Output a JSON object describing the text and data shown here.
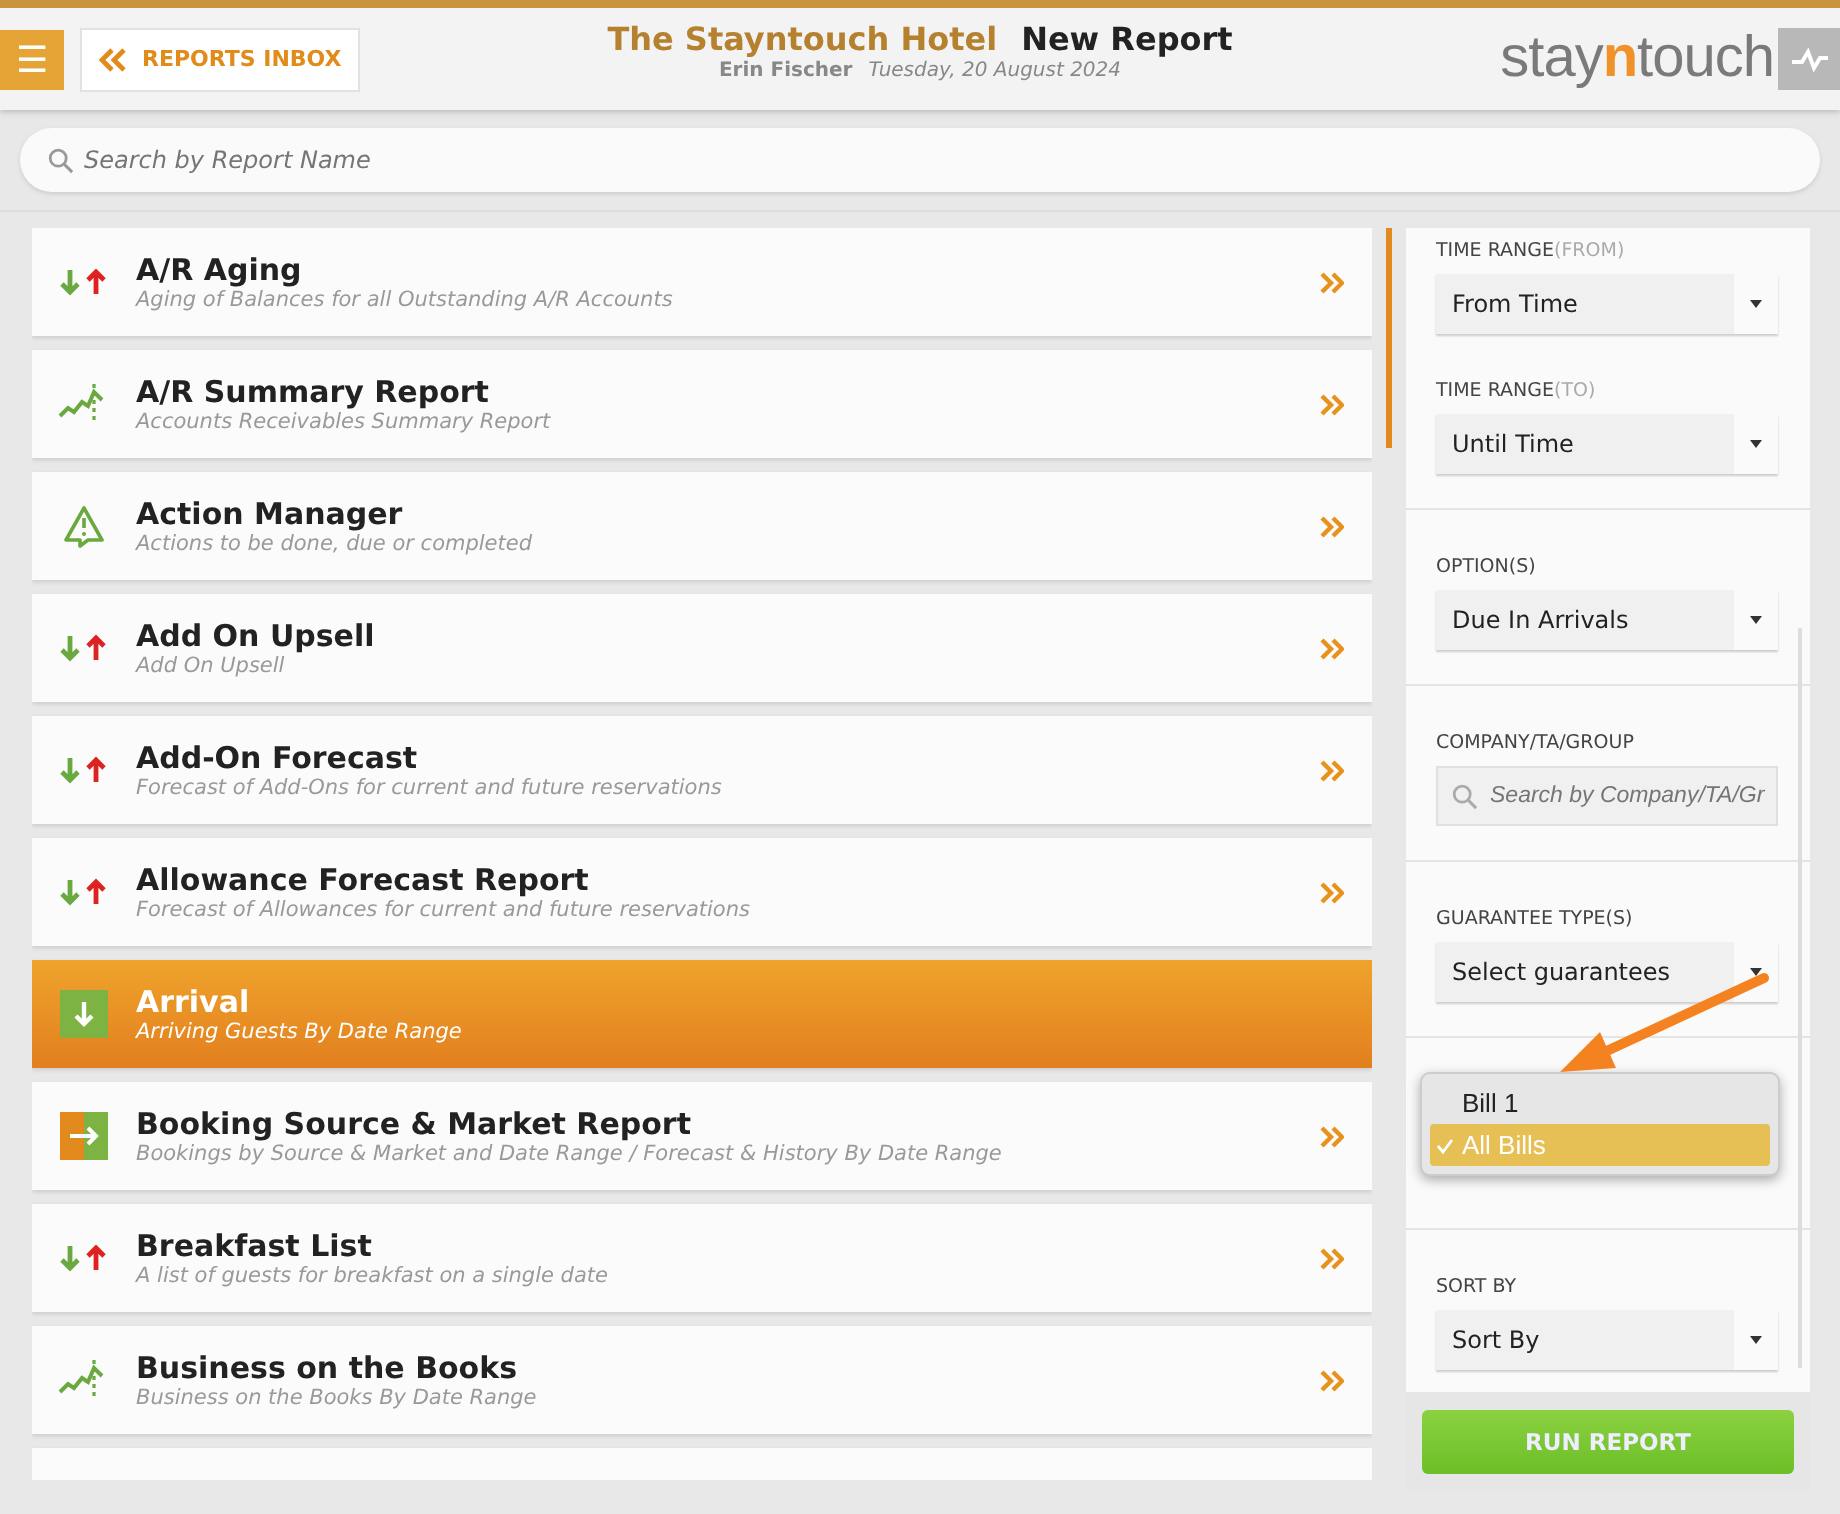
{
  "header": {
    "menu_icon": "☰",
    "back_button": "REPORTS INBOX",
    "hotel_name": "The Stayntouch Hotel",
    "page_title": "New Report",
    "user": "Erin Fischer",
    "date": "Tuesday, 20 August 2024",
    "logo": {
      "before": "stay",
      "accent": "n",
      "after": "touch"
    }
  },
  "search": {
    "placeholder": "Search by Report Name"
  },
  "reports": [
    {
      "title": "A/R Aging",
      "subtitle": "Aging of Balances for all Outstanding A/R Accounts",
      "kind": "arrows",
      "selected": false
    },
    {
      "title": "A/R Summary Report",
      "subtitle": "Accounts Receivables Summary Report",
      "kind": "chart",
      "selected": false
    },
    {
      "title": "Action Manager",
      "subtitle": "Actions to be done, due or completed",
      "kind": "warning",
      "selected": false
    },
    {
      "title": "Add On Upsell",
      "subtitle": "Add On Upsell",
      "kind": "arrows",
      "selected": false
    },
    {
      "title": "Add-On Forecast",
      "subtitle": "Forecast of Add-Ons for current and future reservations",
      "kind": "arrows",
      "selected": false
    },
    {
      "title": "Allowance Forecast Report",
      "subtitle": "Forecast of Allowances for current and future reservations",
      "kind": "arrows",
      "selected": false
    },
    {
      "title": "Arrival",
      "subtitle": "Arriving Guests By Date Range",
      "kind": "arrival",
      "selected": true
    },
    {
      "title": "Booking Source & Market Report",
      "subtitle": "Bookings by Source & Market and Date Range / Forecast & History By Date Range",
      "kind": "booking",
      "selected": false
    },
    {
      "title": "Breakfast List",
      "subtitle": "A list of guests for breakfast on a single date",
      "kind": "arrows",
      "selected": false
    },
    {
      "title": "Business on the Books",
      "subtitle": "Business on the Books By Date Range",
      "kind": "chart",
      "selected": false
    }
  ],
  "filters": [
    {
      "kind": "select",
      "label": "TIME RANGE",
      "note": "(FROM)",
      "value": "From Time"
    },
    {
      "kind": "select",
      "label": "TIME RANGE",
      "note": "(TO)",
      "value": "Until Time"
    },
    {
      "kind": "select",
      "label": "OPTION(S)",
      "value": "Due In Arrivals"
    },
    {
      "kind": "search",
      "label": "COMPANY/TA/GROUP",
      "placeholder": "Search by Company/TA/Gr"
    },
    {
      "kind": "select",
      "label": "GUARANTEE TYPE(S)",
      "value": "Select guarantees"
    },
    {
      "kind": "popup",
      "options": [
        {
          "label": "Bill 1",
          "selected": false
        },
        {
          "label": "All Bills",
          "selected": true
        }
      ]
    },
    {
      "kind": "select",
      "label": "SORT BY",
      "value": "Sort By"
    }
  ],
  "run_button": "RUN REPORT"
}
